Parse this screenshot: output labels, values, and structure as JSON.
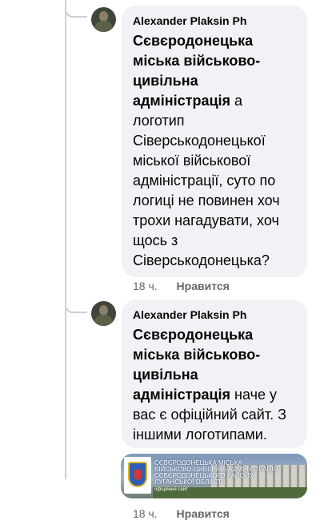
{
  "comments": [
    {
      "author": "Alexander Plaksin Ph",
      "text_bold": "Сєвєродонецька міська військово-цивільна адміністрація",
      "text_rest": " а логотип Сіверськодонецької міської військової адміністрації, суто по логиці не повинен хоч трохи нагадувати, хоч щось з Сіверськодонецька?",
      "time": "18 ч.",
      "like_label": "Нравится"
    },
    {
      "author": "Alexander Plaksin Ph",
      "text_bold": "Сєвєродонецька міська військово-цивільна адміністрація",
      "text_rest": " наче у вас є офіційний сайт. З іншими логотипами.",
      "time": "18 ч.",
      "like_label": "Нравится",
      "link_preview": {
        "lines": [
          "Сєвєродонецька міська",
          "військово-цивільна адміністрація",
          "Сєвєродонецького району",
          "Луганської області"
        ],
        "footer": "офіційний сайт"
      }
    }
  ],
  "icons": {
    "avatar": "user-avatar",
    "preview_logo": "coat-of-arms-icon"
  }
}
